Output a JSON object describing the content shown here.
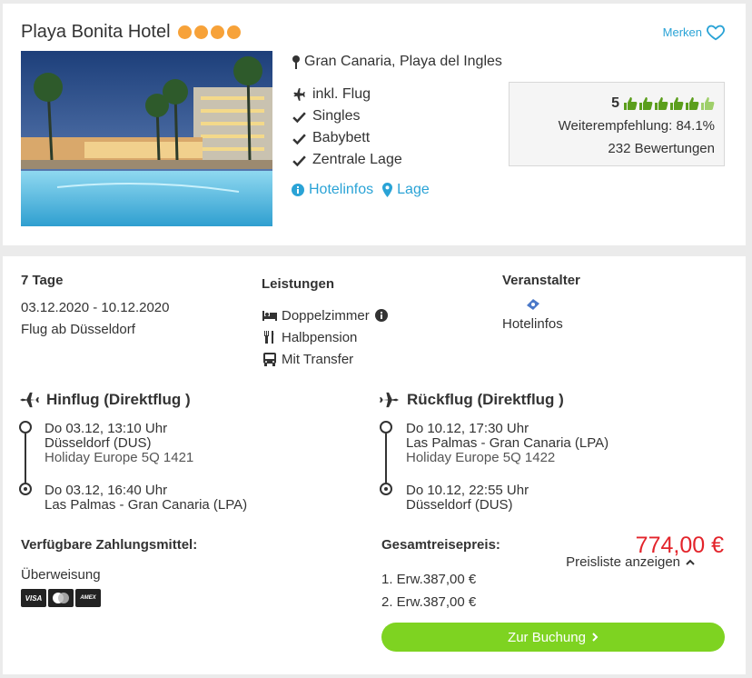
{
  "hotel": {
    "name": "Playa Bonita Hotel",
    "stars": 4,
    "merken_label": "Merken",
    "location": "Gran Canaria, Playa del Ingles",
    "features": [
      "inkl. Flug",
      "Singles",
      "Babybett",
      "Zentrale Lage"
    ],
    "links": {
      "hotelinfos": "Hotelinfos",
      "lage": "Lage"
    },
    "rating": {
      "score": "5",
      "thumbs_count": 6,
      "recommendation": "Weiterempfehlung: 84.1%",
      "reviews": "232 Bewertungen"
    }
  },
  "trip": {
    "duration": "7 Tage",
    "dates": "03.12.2020 - 10.12.2020",
    "departure": "Flug ab Düsseldorf",
    "services_heading": "Leistungen",
    "services": [
      "Doppelzimmer",
      "Halbpension",
      "Mit Transfer"
    ],
    "operator_heading": "Veranstalter",
    "operator_link": "Hotelinfos"
  },
  "outbound": {
    "heading": "Hinflug (Direktflug )",
    "dep_time": "Do 03.12, 13:10 Uhr",
    "dep_airport": "Düsseldorf (DUS)",
    "flight": "Holiday Europe 5Q 1421",
    "arr_time": "Do 03.12, 16:40 Uhr",
    "arr_airport": "Las Palmas - Gran Canaria (LPA)"
  },
  "return": {
    "heading": "Rückflug (Direktflug )",
    "dep_time": "Do 10.12, 17:30 Uhr",
    "dep_airport": "Las Palmas - Gran Canaria (LPA)",
    "flight": "Holiday Europe 5Q 1422",
    "arr_time": "Do 10.12, 22:55 Uhr",
    "arr_airport": "Düsseldorf (DUS)"
  },
  "payment": {
    "heading": "Verfügbare Zahlungsmittel:",
    "method": "Überweisung",
    "cards": [
      "VISA",
      "MC",
      "AMEX"
    ]
  },
  "pricing": {
    "heading": "Gesamtreisepreis:",
    "total": "774,00 €",
    "price_list_label": "Preisliste anzeigen",
    "lines": [
      "1. Erw.387,00 €",
      "2. Erw.387,00 €"
    ],
    "book_label": "Zur Buchung"
  },
  "colors": {
    "accent_blue": "#2aa3d6",
    "star_orange": "#f7a239",
    "price_red": "#e3242b",
    "button_green": "#7ed321",
    "thumb_green": "#5b9e1c"
  }
}
